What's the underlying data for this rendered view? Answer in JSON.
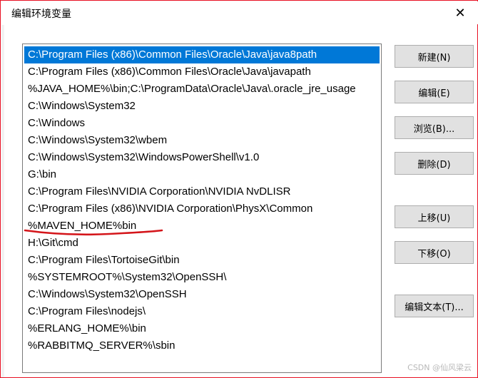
{
  "window": {
    "title": "编辑环境变量",
    "close_glyph": "✕"
  },
  "path_list": {
    "selected_index": 0,
    "items": [
      "C:\\Program Files (x86)\\Common Files\\Oracle\\Java\\java8path",
      "C:\\Program Files (x86)\\Common Files\\Oracle\\Java\\javapath",
      "%JAVA_HOME%\\bin;C:\\ProgramData\\Oracle\\Java\\.oracle_jre_usage",
      "C:\\Windows\\System32",
      "C:\\Windows",
      "C:\\Windows\\System32\\wbem",
      "C:\\Windows\\System32\\WindowsPowerShell\\v1.0",
      "G:\\bin",
      "C:\\Program Files\\NVIDIA Corporation\\NVIDIA NvDLISR",
      "C:\\Program Files (x86)\\NVIDIA Corporation\\PhysX\\Common",
      "%MAVEN_HOME%bin",
      "H:\\Git\\cmd",
      "C:\\Program Files\\TortoiseGit\\bin",
      "%SYSTEMROOT%\\System32\\OpenSSH\\",
      "C:\\Windows\\System32\\OpenSSH",
      "C:\\Program Files\\nodejs\\",
      "%ERLANG_HOME%\\bin",
      "%RABBITMQ_SERVER%\\sbin"
    ]
  },
  "buttons": {
    "new": "新建(N)",
    "edit": "编辑(E)",
    "browse": "浏览(B)...",
    "delete": "删除(D)",
    "move_up": "上移(U)",
    "move_down": "下移(O)",
    "edit_text": "编辑文本(T)..."
  },
  "annotation_color": "#d4151a",
  "watermark": "CSDN @仙风梁云",
  "colors": {
    "selection": "#0078d7",
    "button_face": "#e1e1e1",
    "window_border": "#e81123"
  }
}
